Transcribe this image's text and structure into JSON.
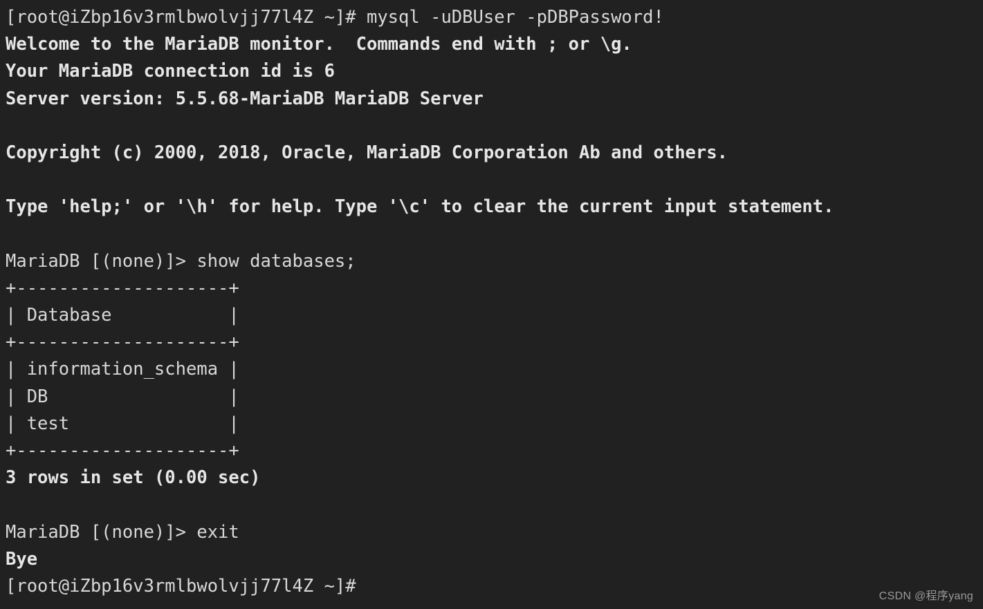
{
  "terminal": {
    "background_color": "#212121",
    "foreground_color": "#d8d8d8",
    "prompt_user_host": "[root@iZbp16v3rmlbwolvjj77l4Z ~]#",
    "hostname": "iZbp16v3rmlbwolvjj77l4Z",
    "user": "root",
    "cwd": "~",
    "lines": [
      {
        "text": "[root@iZbp16v3rmlbwolvjj77l4Z ~]# mysql -uDBUser -pDBPassword!",
        "bold": false
      },
      {
        "text": "Welcome to the MariaDB monitor.  Commands end with ; or \\g.",
        "bold": true
      },
      {
        "text": "Your MariaDB connection id is 6",
        "bold": true
      },
      {
        "text": "Server version: 5.5.68-MariaDB MariaDB Server",
        "bold": true
      },
      {
        "text": "",
        "bold": false
      },
      {
        "text": "Copyright (c) 2000, 2018, Oracle, MariaDB Corporation Ab and others.",
        "bold": true
      },
      {
        "text": "",
        "bold": false
      },
      {
        "text": "Type 'help;' or '\\h' for help. Type '\\c' to clear the current input statement.",
        "bold": true
      },
      {
        "text": "",
        "bold": false
      },
      {
        "text": "MariaDB [(none)]> show databases;",
        "bold": false
      },
      {
        "text": "+--------------------+",
        "bold": false
      },
      {
        "text": "| Database           |",
        "bold": false
      },
      {
        "text": "+--------------------+",
        "bold": false
      },
      {
        "text": "| information_schema |",
        "bold": false
      },
      {
        "text": "| DB                 |",
        "bold": false
      },
      {
        "text": "| test               |",
        "bold": false
      },
      {
        "text": "+--------------------+",
        "bold": false
      },
      {
        "text": "3 rows in set (0.00 sec)",
        "bold": true
      },
      {
        "text": "",
        "bold": false
      },
      {
        "text": "MariaDB [(none)]> exit",
        "bold": false
      },
      {
        "text": "Bye",
        "bold": true
      },
      {
        "text": "[root@iZbp16v3rmlbwolvjj77l4Z ~]#",
        "bold": false
      }
    ],
    "commands": [
      "mysql -uDBUser -pDBPassword!",
      "show databases;",
      "exit"
    ],
    "mysql_client": {
      "welcome": "Welcome to the MariaDB monitor.",
      "commands_end_with": "Commands end with ; or \\g.",
      "connection_id": "6",
      "server_version": "5.5.68-MariaDB",
      "server_name": "MariaDB Server",
      "copyright": "Copyright (c) 2000, 2018, Oracle, MariaDB Corporation Ab and others.",
      "help_hint": "Type 'help;' or '\\h' for help. Type '\\c' to clear the current input statement.",
      "prompt": "MariaDB [(none)]>",
      "database_context": "(none)",
      "goodbye": "Bye"
    },
    "result_table": {
      "border": "+--------------------+",
      "columns": [
        "Database"
      ],
      "rows": [
        [
          "information_schema"
        ],
        [
          "DB"
        ],
        [
          "test"
        ]
      ],
      "row_count_text": "3 rows in set (0.00 sec)",
      "row_count": 3,
      "elapsed": "0.00 sec"
    }
  },
  "watermark": {
    "text": "CSDN @程序yang"
  }
}
